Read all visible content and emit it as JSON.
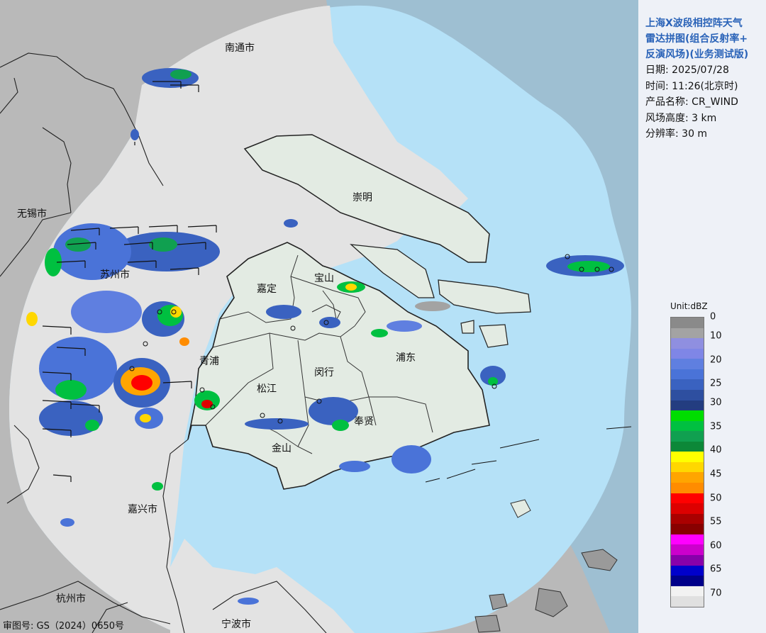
{
  "panel": {
    "title_line1": "上海X波段相控阵天气",
    "title_line2": "雷达拼图(组合反射率+",
    "title_line3": "反演风场)(业务测试版)",
    "date": "日期: 2025/07/28",
    "time": "时间: 11:26(北京时)",
    "product": "产品名称: CR_WIND",
    "wind_height": "风场高度: 3 km",
    "resolution": "分辨率: 30 m"
  },
  "legend": {
    "unit": "Unit:dBZ",
    "ticks": [
      "0",
      "10",
      "20",
      "25",
      "30",
      "35",
      "40",
      "45",
      "50",
      "55",
      "60",
      "65",
      "70"
    ],
    "colors": [
      "#8a8a8a",
      "#a3a3a3",
      "#8f8fe0",
      "#7f86e6",
      "#5f7fe0",
      "#4a73d8",
      "#3a62c0",
      "#2e4fa0",
      "#233d80",
      "#00dd00",
      "#00c040",
      "#10a050",
      "#0c8838",
      "#ffff00",
      "#ffd700",
      "#ffa500",
      "#ff8c00",
      "#ff0000",
      "#dd0000",
      "#aa0000",
      "#880000",
      "#ff00ff",
      "#cc00cc",
      "#8800aa",
      "#0000cc",
      "#00008a",
      "#f2f2f2",
      "#e0e0e0"
    ]
  },
  "cities": {
    "nantong": "南通市",
    "wuxi": "无锡市",
    "suzhou": "苏州市",
    "jiaxing": "嘉兴市",
    "hangzhou": "杭州市",
    "ningbo": "宁波市"
  },
  "districts": {
    "chongming": "崇明",
    "jiading": "嘉定",
    "baoshan": "宝山",
    "qingpu": "青浦",
    "pudong": "浦东",
    "minhang": "闵行",
    "songjiang": "松江",
    "fengxian": "奉贤",
    "jinshan": "金山"
  },
  "approval": "审图号: GS（2024）0650号",
  "colors": {
    "water": "#b5e1f7",
    "land_in_range": "#e3e3e3",
    "land_out_of_range": "#b9b9b9",
    "shanghai_land": "#e3ebe3",
    "sea_out_of_range": "#9ebfd2",
    "title_blue": "#2a63b8"
  }
}
